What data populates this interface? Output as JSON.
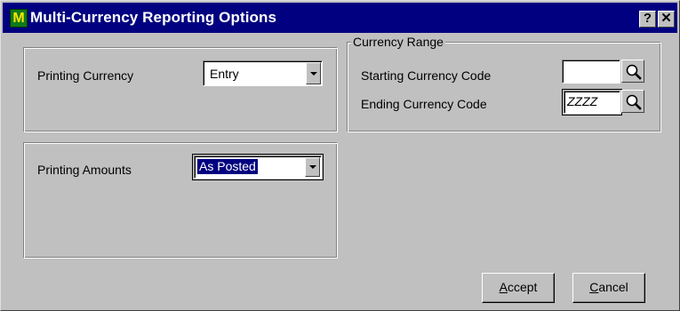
{
  "window": {
    "title": "Multi-Currency Reporting Options",
    "help_button": "?",
    "close_button": "✕"
  },
  "printing_currency": {
    "label": "Printing Currency",
    "value": "Entry"
  },
  "printing_amounts": {
    "label": "Printing Amounts",
    "value": "As Posted"
  },
  "currency_range": {
    "legend": "Currency Range",
    "starting_label": "Starting Currency Code",
    "starting_value": "",
    "ending_label": "Ending Currency Code",
    "ending_value": "ZZZZ"
  },
  "buttons": {
    "accept": {
      "mnemonic": "A",
      "rest": "ccept"
    },
    "cancel": {
      "mnemonic": "C",
      "rest": "ancel"
    }
  },
  "icons": {
    "app": "mas90-app-icon",
    "lookup": "magnifier-icon",
    "dropdown": "chevron-down-icon"
  },
  "colors": {
    "titlebar": "#000080",
    "face": "#c0c0c0",
    "selection": "#000080"
  }
}
